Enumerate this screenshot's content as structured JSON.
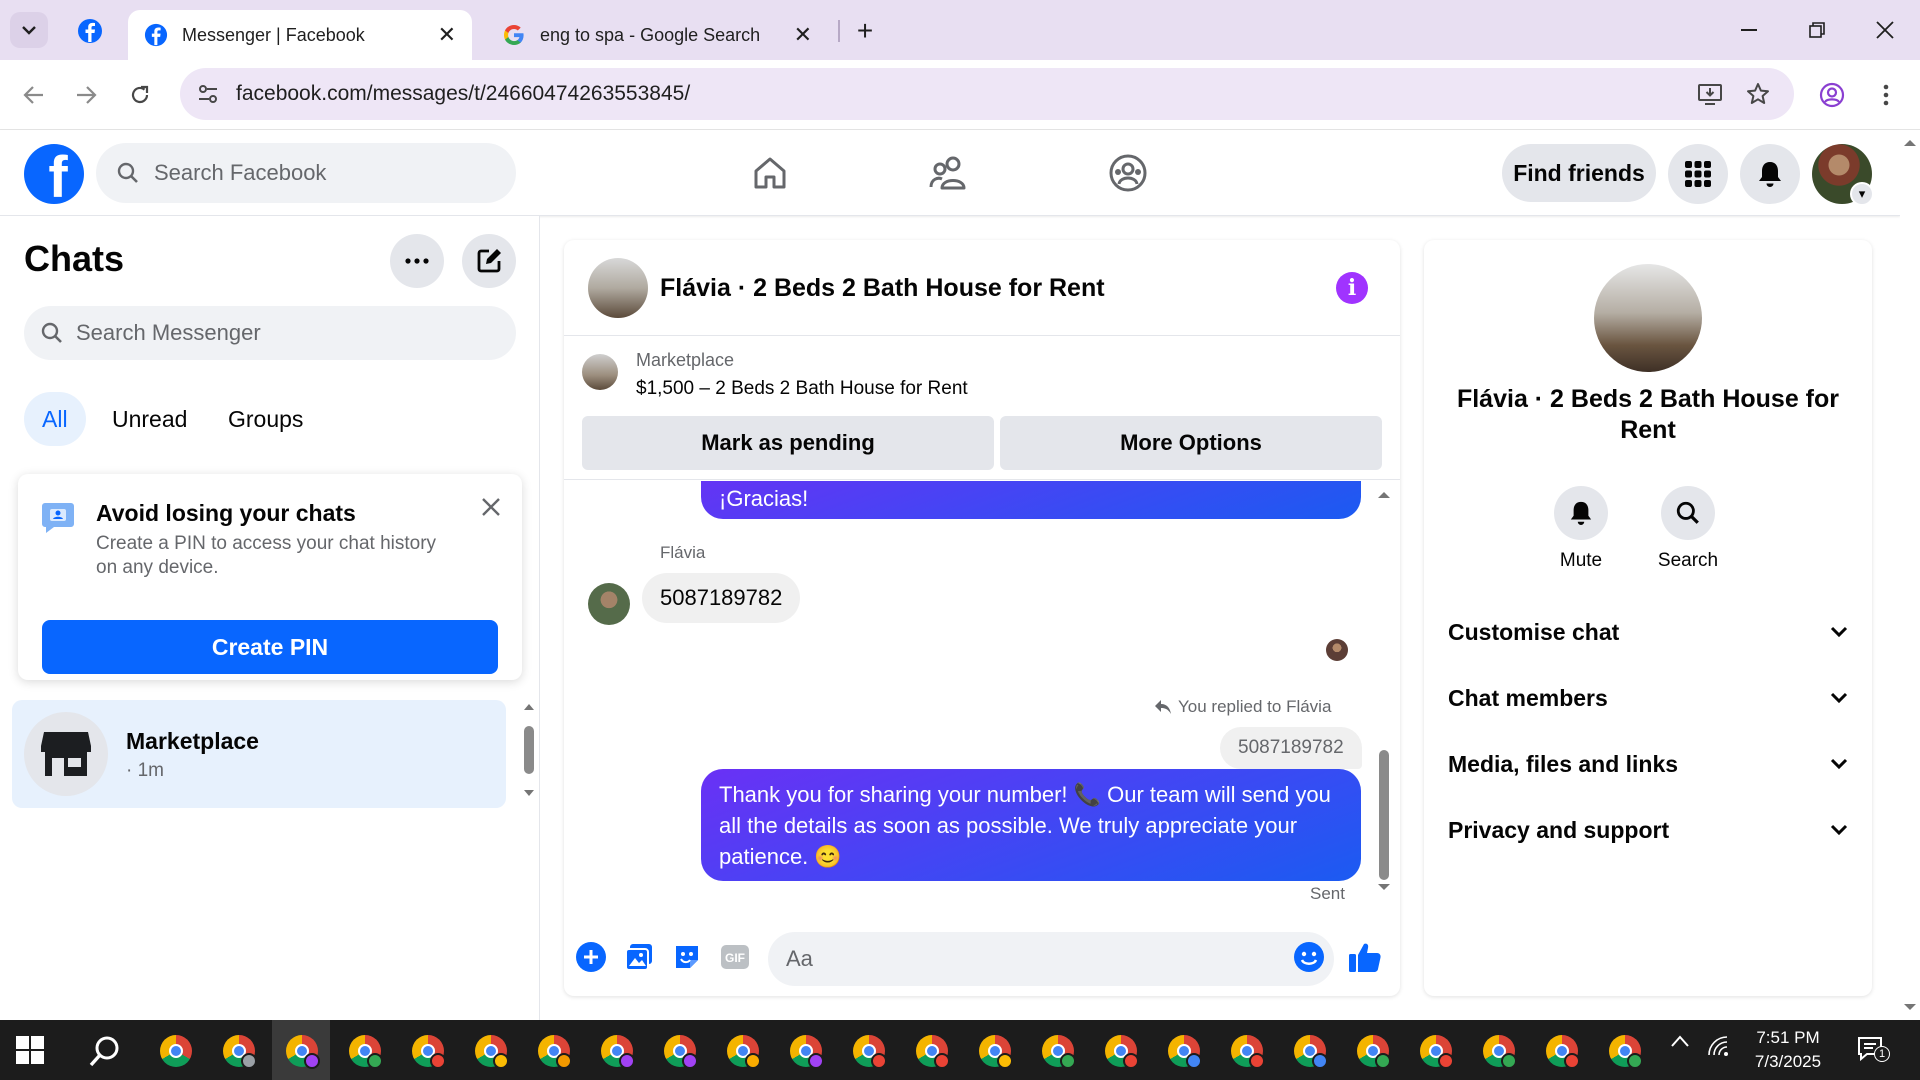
{
  "browser": {
    "tabs": [
      {
        "title": "Messenger | Facebook",
        "icon": "facebook-icon",
        "active": true
      },
      {
        "title": "eng to spa - Google Search",
        "icon": "google-icon",
        "active": false
      }
    ],
    "url": "facebook.com/messages/t/24660474263553845/"
  },
  "fb": {
    "search_placeholder": "Search Facebook",
    "find_friends": "Find friends"
  },
  "left": {
    "title": "Chats",
    "search_placeholder": "Search Messenger",
    "filters": [
      "All",
      "Unread",
      "Groups"
    ],
    "pin_card": {
      "title": "Avoid losing your chats",
      "body": "Create a PIN to access your chat history on any device.",
      "button": "Create PIN"
    },
    "chat": {
      "name": "Marketplace",
      "time": "· 1m"
    }
  },
  "conversation": {
    "title": "Flávia · 2 Beds 2 Bath House for Rent",
    "marketplace_label": "Marketplace",
    "listing": "$1,500 – 2 Beds 2 Bath House for Rent",
    "buttons": {
      "pending": "Mark as pending",
      "more": "More Options"
    },
    "messages": {
      "out_partial": "¡Gracias!",
      "sender": "Flávia",
      "in_text": "5087189782",
      "reply_label": "You replied to Flávia",
      "reply_quote": "5087189782",
      "out_main": "Thank you for sharing your number! 📞 Our team will send you all the details as soon as possible. We truly appreciate your patience. 😊",
      "status": "Sent"
    },
    "composer_placeholder": "Aa"
  },
  "info_panel": {
    "name": "Flávia · 2 Beds 2 Bath House for Rent",
    "actions": [
      "Mute",
      "Search"
    ],
    "sections": [
      "Customise chat",
      "Chat members",
      "Media, files and links",
      "Privacy and support"
    ]
  },
  "taskbar": {
    "time": "7:51 PM",
    "date": "7/3/2025",
    "notification_count": "1"
  },
  "colors": {
    "facebook_blue": "#0866ff",
    "messenger_purple": "#a033ff",
    "chrome_frame": "#e8dff2"
  }
}
